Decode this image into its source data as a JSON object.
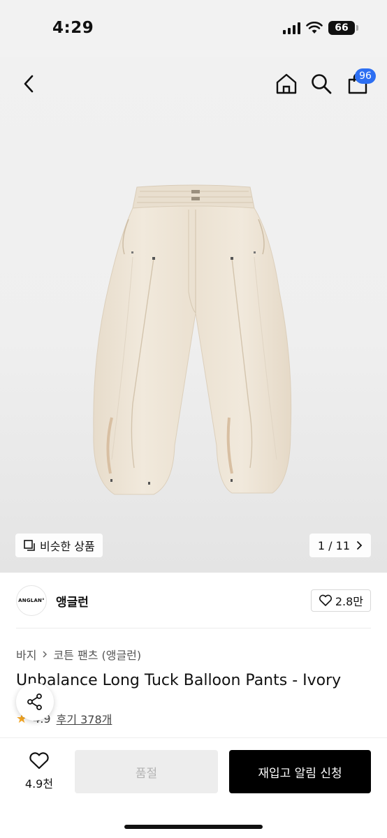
{
  "status_bar": {
    "time": "4:29",
    "battery": "66"
  },
  "header": {
    "cart_count": "96"
  },
  "gallery": {
    "similar_label": "비슷한 상품",
    "page_indicator": "1 / 11"
  },
  "brand": {
    "logo_text": "ANGLAN°",
    "name": "앵글런",
    "likes": "2.8만"
  },
  "breadcrumb": {
    "category": "바지",
    "subcategory": "코튼 팬츠 (앵글런)"
  },
  "product": {
    "title": "Unbalance Long Tuck Balloon Pants - Ivory",
    "rating": "4.9",
    "reviews": "후기 378개"
  },
  "bottom_bar": {
    "wish_count": "4.9천",
    "soldout_label": "품절",
    "restock_label": "재입고 알림 신청"
  },
  "colors": {
    "accent": "#2d6ff2",
    "product": "#efe6d6",
    "cta": "#000000"
  },
  "icons": [
    "back-icon",
    "home-icon",
    "search-icon",
    "cart-icon",
    "similar-icon",
    "chevron-right-icon",
    "heart-icon",
    "share-icon",
    "star-icon"
  ]
}
